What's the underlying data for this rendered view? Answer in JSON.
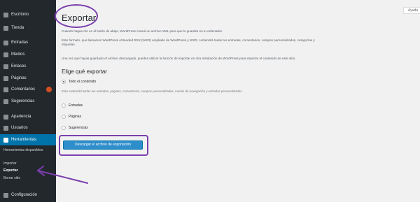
{
  "sidebar": {
    "items": [
      {
        "label": "Escritorio",
        "icon": "dashboard-icon"
      },
      {
        "label": "Tienda",
        "icon": "store-icon"
      },
      {
        "label": "Entradas",
        "icon": "pin-icon"
      },
      {
        "label": "Medios",
        "icon": "media-icon"
      },
      {
        "label": "Enlaces",
        "icon": "link-icon"
      },
      {
        "label": "Páginas",
        "icon": "pages-icon"
      },
      {
        "label": "Comentarios",
        "icon": "comments-icon"
      },
      {
        "label": "Sugerencias",
        "icon": "suggestions-icon"
      },
      {
        "label": "Apariencia",
        "icon": "appearance-icon"
      },
      {
        "label": "Usuarios",
        "icon": "users-icon"
      },
      {
        "label": "Herramientas",
        "icon": "tools-icon"
      },
      {
        "label": "Configuración",
        "icon": "settings-icon"
      }
    ],
    "submenu": [
      "Herramientas disponibles",
      "Importar",
      "Exportar",
      "Borrar sitio"
    ]
  },
  "help_tab": "Ayuda",
  "page": {
    "title": "Exportar",
    "intro_1": "Cuando hagas clic en el botón de abajo, WordPress creará un archivo XML para que lo guardes en tu ordenador.",
    "intro_2": "Este formato, que llamamos WordPress eXtended RSS (WXR) ampliado de WordPress y WXR, contendrá todas tus entradas, comentarios, campos personalizados, categorías y etiquetas.",
    "intro_3": "Una vez que hayas guardado el archivo descargado, puedes utilizar la función de importar en otra instalación de WordPress para importar el contenido de este sitio.",
    "heading": "Elige qué exportar",
    "options": [
      "Todo el contenido",
      "Entradas",
      "Páginas",
      "Sugerencias"
    ],
    "note": "Esto contendrá todas tus entradas, páginas, comentarios, campos personalizados, menús de navegación y entradas personalizadas.",
    "download_button": "Descargar el archivo de exportación"
  },
  "colors": {
    "sidebar_bg": "#23282d",
    "active_menu": "#0073aa",
    "annotation": "#7b3fae",
    "button": "#2e8ecb"
  }
}
